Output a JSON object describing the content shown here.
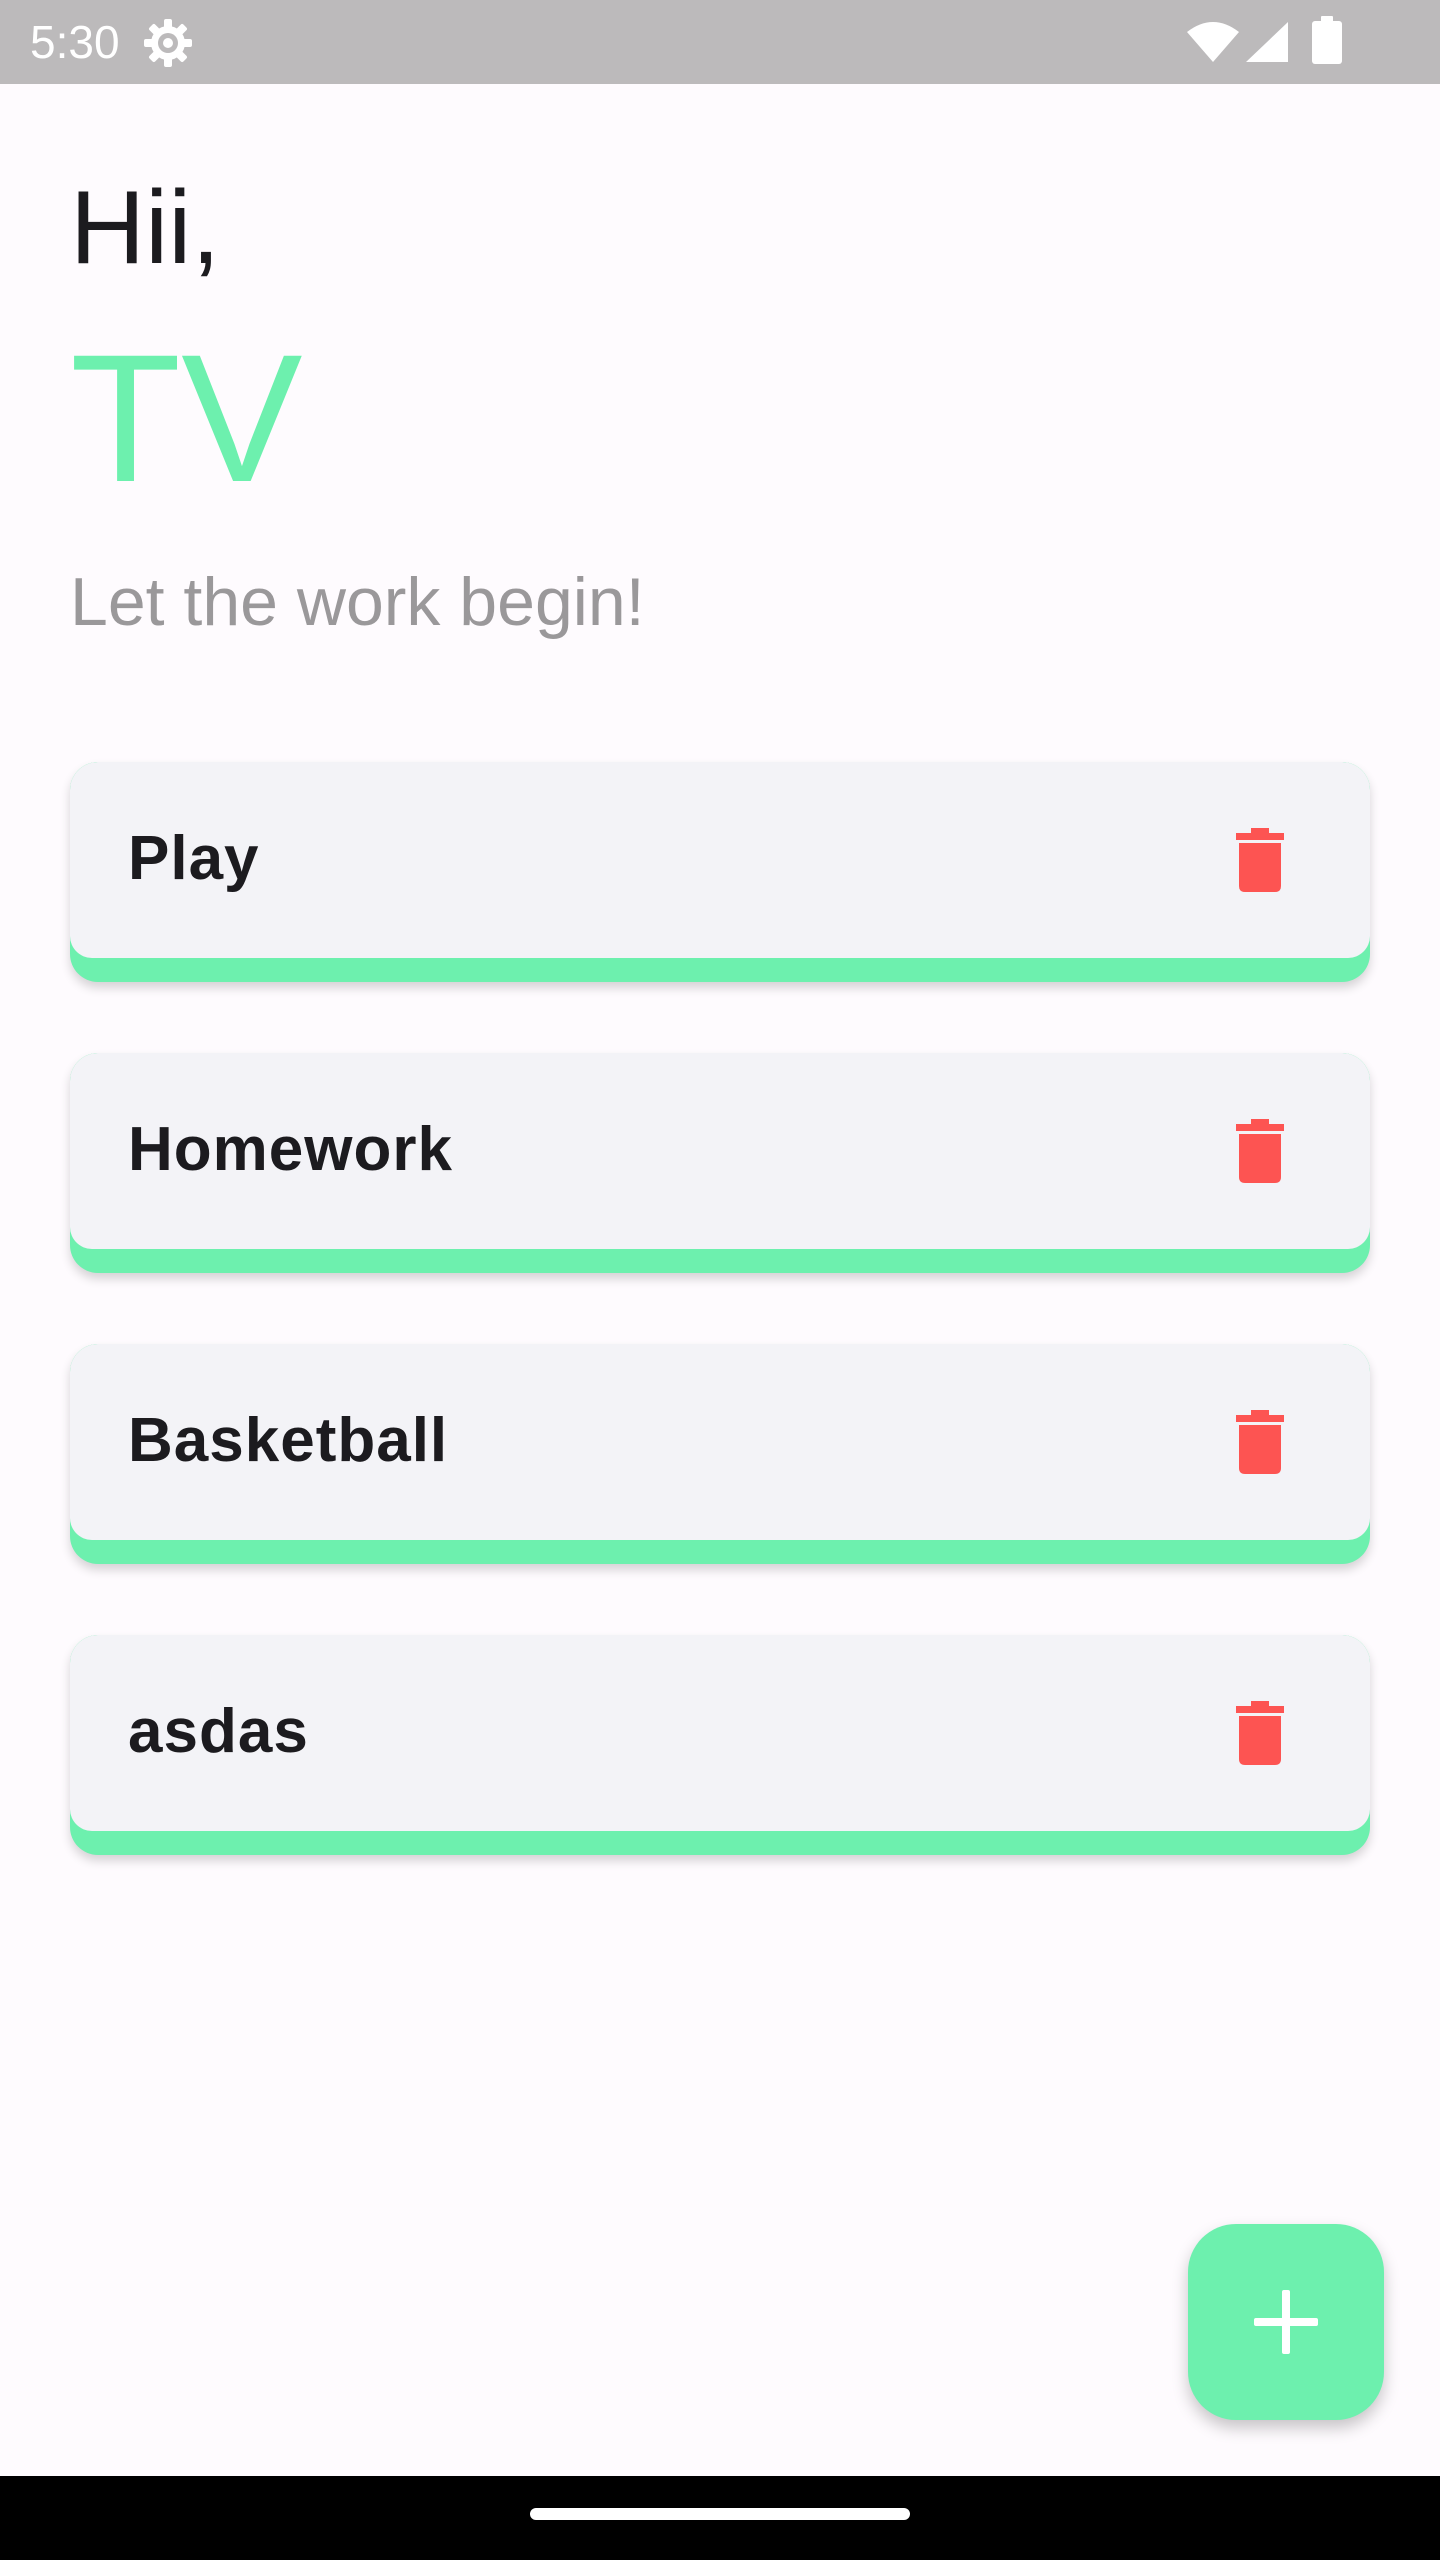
{
  "status_bar": {
    "time": "5:30",
    "icons": [
      "settings-icon",
      "wifi-icon",
      "signal-icon",
      "battery-icon"
    ]
  },
  "header": {
    "greeting": "Hii,",
    "name": "TV",
    "subtitle": "Let the work begin!"
  },
  "tasks": [
    {
      "title": "Play"
    },
    {
      "title": "Homework"
    },
    {
      "title": "Basketball"
    },
    {
      "title": "asdas"
    }
  ],
  "fab": {
    "icon": "plus-icon"
  },
  "colors": {
    "accent": "#6df0ae",
    "delete": "#fd5452",
    "card_background": "#f3f3f7",
    "status_bar": "#bcbabb",
    "subtitle_text": "#9a989a"
  }
}
